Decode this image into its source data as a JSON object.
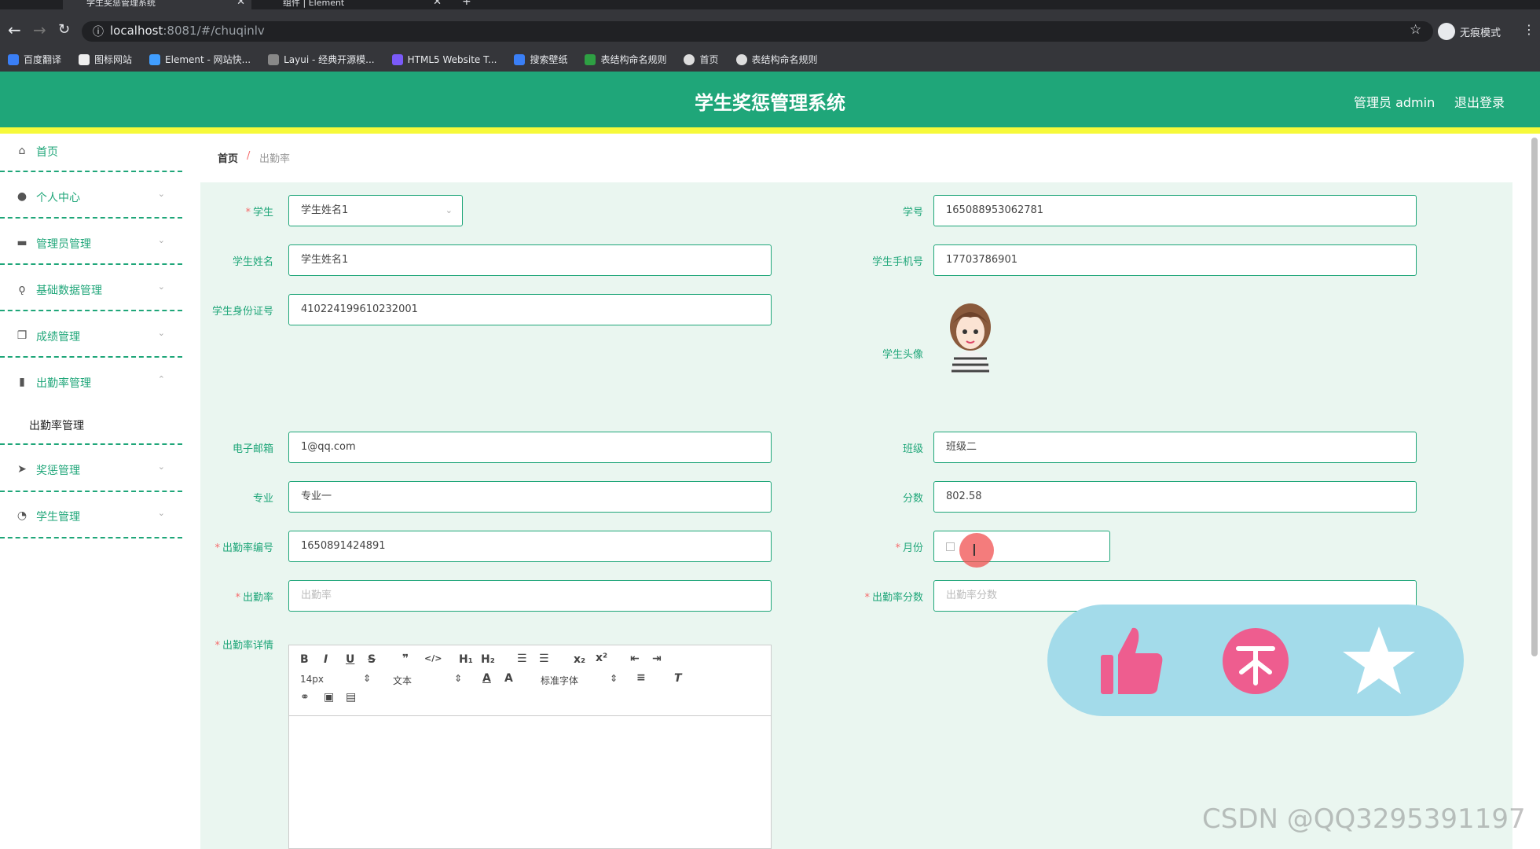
{
  "browser": {
    "tabs": [
      {
        "title": "学生奖惩管理系统",
        "active": true
      },
      {
        "title": "组件 | Element",
        "active": false
      }
    ],
    "url_host": "localhost",
    "url_rest": ":8081/#/chuqinlv",
    "incognito_label": "无痕模式",
    "bookmarks": [
      "百度翻译",
      "图标网站",
      "Element - 网站快...",
      "Layui - 经典开源模...",
      "HTML5 Website T...",
      "搜索壁纸",
      "表结构命名规则",
      "首页",
      "表结构命名规则"
    ]
  },
  "header": {
    "title": "学生奖惩管理系统",
    "admin": "管理员 admin",
    "logout": "退出登录"
  },
  "sidebar": {
    "items": [
      {
        "label": "首页",
        "icon": "home-icon"
      },
      {
        "label": "个人中心",
        "icon": "user-icon"
      },
      {
        "label": "管理员管理",
        "icon": "chat-icon"
      },
      {
        "label": "基础数据管理",
        "icon": "mic-icon"
      },
      {
        "label": "成绩管理",
        "icon": "copy-icon"
      },
      {
        "label": "出勤率管理",
        "icon": "chart-icon"
      },
      {
        "label": "奖惩管理",
        "icon": "send-icon"
      },
      {
        "label": "学生管理",
        "icon": "clock-icon"
      }
    ],
    "sub_item": "出勤率管理"
  },
  "breadcrumb": {
    "home": "首页",
    "sep": "/",
    "current": "出勤率"
  },
  "form": {
    "student_label": "学生",
    "student_value": "学生姓名1",
    "xuehao_label": "学号",
    "xuehao_value": "165088953062781",
    "name_label": "学生姓名",
    "name_value": "学生姓名1",
    "phone_label": "学生手机号",
    "phone_value": "17703786901",
    "idcard_label": "学生身份证号",
    "idcard_value": "410224199610232001",
    "avatar_label": "学生头像",
    "email_label": "电子邮箱",
    "email_value": "1@qq.com",
    "class_label": "班级",
    "class_value": "班级二",
    "major_label": "专业",
    "major_value": "专业一",
    "score_label": "分数",
    "score_value": "802.58",
    "attno_label": "出勤率编号",
    "attno_value": "1650891424891",
    "month_label": "月份",
    "rate_label": "出勤率",
    "rate_placeholder": "出勤率",
    "ratescore_label": "出勤率分数",
    "ratescore_placeholder": "出勤率分数",
    "detail_label": "出勤率详情",
    "editor": {
      "font_size": "14px",
      "block": "文本",
      "font": "标准字体"
    }
  },
  "watermark": "CSDN @QQ3295391197",
  "colors": {
    "primary": "#1fa679",
    "accent_yellow": "#f6f93a",
    "required": "#f56c6c",
    "overlay": "#a3dbea",
    "overlay_icon": "#ee5d8f"
  }
}
